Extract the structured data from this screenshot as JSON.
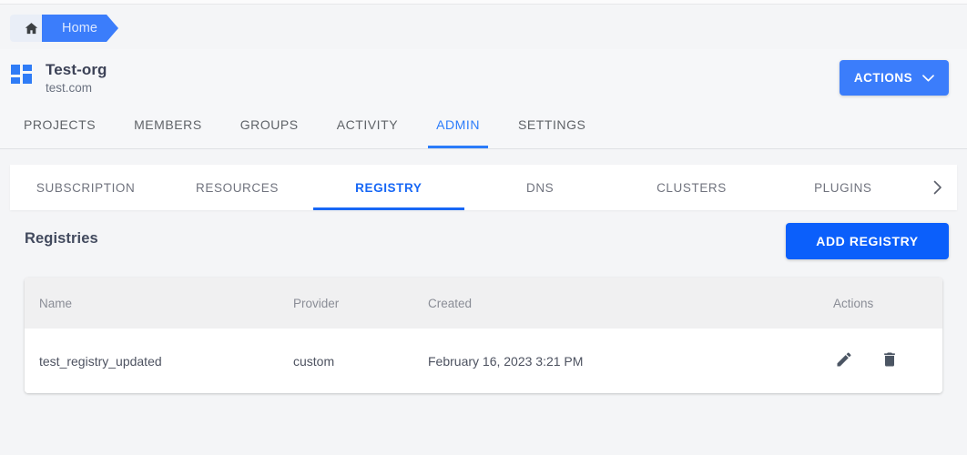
{
  "breadcrumb": {
    "home_icon": "home-icon",
    "items": [
      {
        "label": "Home",
        "active": true
      }
    ]
  },
  "org": {
    "logo_icon": "grid-logo-icon",
    "name": "Test-org",
    "domain": "test.com",
    "actions_button": "ACTIONS",
    "actions_chevron_icon": "chevron-down-icon"
  },
  "main_tabs": [
    {
      "label": "PROJECTS",
      "active": false
    },
    {
      "label": "MEMBERS",
      "active": false
    },
    {
      "label": "GROUPS",
      "active": false
    },
    {
      "label": "ACTIVITY",
      "active": false
    },
    {
      "label": "ADMIN",
      "active": true
    },
    {
      "label": "SETTINGS",
      "active": false
    }
  ],
  "sub_tabs": [
    {
      "label": "SUBSCRIPTION",
      "active": false
    },
    {
      "label": "RESOURCES",
      "active": false
    },
    {
      "label": "REGISTRY",
      "active": true
    },
    {
      "label": "DNS",
      "active": false
    },
    {
      "label": "CLUSTERS",
      "active": false
    },
    {
      "label": "PLUGINS",
      "active": false
    }
  ],
  "sub_tabs_next_icon": "chevron-right-icon",
  "section": {
    "title": "Registries",
    "add_button": "ADD REGISTRY"
  },
  "table": {
    "columns": [
      "Name",
      "Provider",
      "Created",
      "Actions"
    ],
    "rows": [
      {
        "name": "test_registry_updated",
        "provider": "custom",
        "created": "February 16, 2023 3:21 PM",
        "edit_icon": "pencil-icon",
        "delete_icon": "trash-icon"
      }
    ]
  },
  "colors": {
    "accent_blue": "#3b7dfb",
    "active_tab_blue": "#1767f5",
    "add_button_blue": "#0b5ffb",
    "page_bg": "#f4f5f7",
    "card_bg": "#ffffff",
    "table_header_bg": "#f0f0f1"
  }
}
